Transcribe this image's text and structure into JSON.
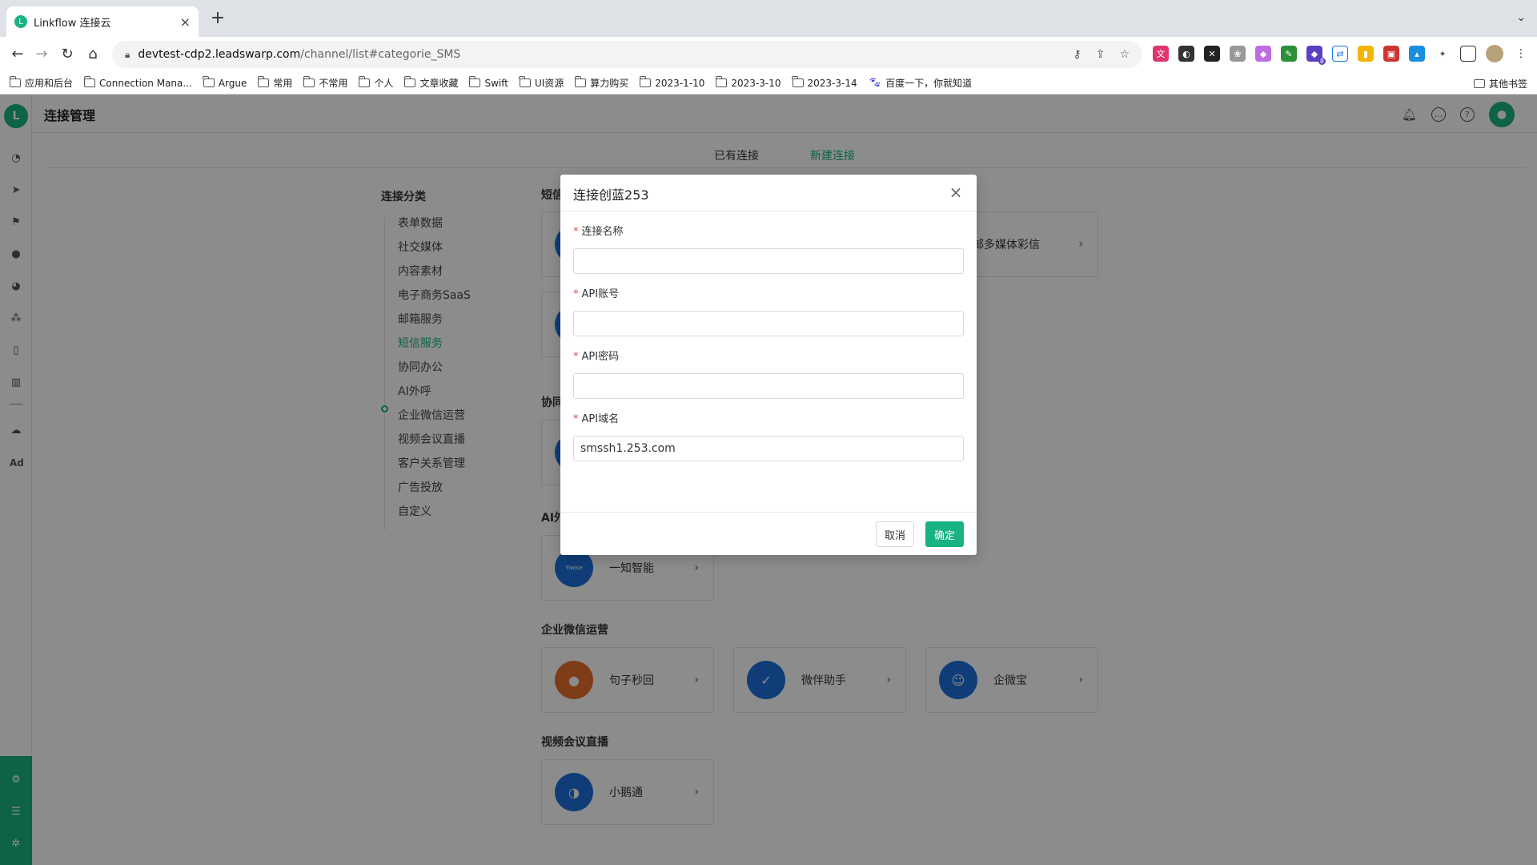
{
  "browser": {
    "tab_title": "Linkflow 连接云",
    "url_host": "devtest-cdp2.leadswarp.com",
    "url_path": "/channel/list#categorie_SMS",
    "bookmarks": [
      "应用和后台",
      "Connection Mana...",
      "Argue",
      "常用",
      "不常用",
      "个人",
      "文章收藏",
      "Swift",
      "UI资源",
      "算力购买",
      "2023-1-10",
      "2023-3-10",
      "2023-3-14"
    ],
    "baidu_bookmark": "百度一下，你就知道",
    "other_bookmarks": "其他书签",
    "extension_badge": "8"
  },
  "app": {
    "page_title": "连接管理",
    "tabs": [
      "已有连接",
      "新建连接"
    ],
    "sidebar_bottom_label": "Ad",
    "category_title": "连接分类",
    "categories": [
      "表单数据",
      "社交媒体",
      "内容素材",
      "电子商务SaaS",
      "邮箱服务",
      "短信服务",
      "协同办公",
      "AI外呼",
      "企业微信运营",
      "视频会议直播",
      "客户关系管理",
      "广告投放",
      "自定义"
    ],
    "sections": {
      "sms": "短信",
      "collab": "协同",
      "ai": "AI外",
      "wecom": "企业微信运营",
      "video": "视频会议直播"
    },
    "cards": {
      "saibu": "赛邮多媒体彩信",
      "yizhi": "一知智能",
      "yizhi_logo": "Yiwise",
      "juzi": "句子秒回",
      "weiban": "微伴助手",
      "qiweibao": "企微宝",
      "xiaoe": "小鹅通"
    }
  },
  "modal": {
    "title": "连接创蓝253",
    "fields": [
      {
        "label": "连接名称",
        "value": ""
      },
      {
        "label": "API账号",
        "value": ""
      },
      {
        "label": "API密码",
        "value": ""
      },
      {
        "label": "API域名",
        "value": "smssh1.253.com"
      }
    ],
    "cancel_label": "取消",
    "ok_label": "确定"
  },
  "colors": {
    "accent": "#19b383",
    "required": "#e64a3b"
  }
}
